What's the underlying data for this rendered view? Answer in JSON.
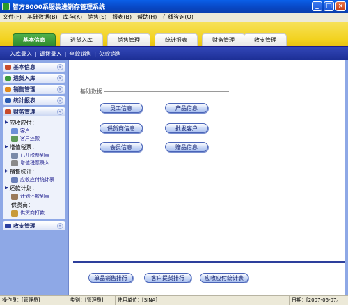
{
  "window": {
    "title": "智方8000系服装进销存管理系统",
    "buttons": {
      "minimize": "_",
      "maximize": "□",
      "close": "×"
    }
  },
  "menu": [
    "文件(F)",
    "基础数据(B)",
    "库存(K)",
    "销售(S)",
    "报表(B)",
    "帮助(H)",
    "在线咨询(O)"
  ],
  "tabs": [
    "基本信息",
    "进货入库",
    "销售管理",
    "统计报表",
    "财务管理",
    "收支管理"
  ],
  "subnav": [
    "入库录入",
    "调拨录入",
    "全款销售",
    "欠款销售"
  ],
  "sidebar": {
    "sections": [
      {
        "label": "基本信息",
        "color": "#c84a2a"
      },
      {
        "label": "进货入库",
        "color": "#3a9a3a"
      },
      {
        "label": "销售管理",
        "color": "#e08a1a"
      },
      {
        "label": "统计报表",
        "color": "#2a5ab0"
      },
      {
        "label": "财务管理",
        "color": "#c84a2a"
      },
      {
        "label": "收支管理",
        "color": "#2a3fa0"
      }
    ],
    "toggle_down": "»",
    "toggle_up": "«",
    "finance": {
      "groups": [
        {
          "label": "应收应付：",
          "items": [
            "客户",
            "客户还款"
          ]
        },
        {
          "label": "增值税票：",
          "items": [
            "已开税票列表",
            "增值税票录入"
          ]
        },
        {
          "label": "销售统计：",
          "items": [
            "应收应付统计表"
          ]
        },
        {
          "label": "还款计划：",
          "items": [
            "计划还款列表"
          ]
        }
      ],
      "supplier_label": "供货商：",
      "supplier_item": "供货商打款"
    }
  },
  "main": {
    "section_title": "基础数据",
    "buttons": [
      "员工信息",
      "产品信息",
      "供货商信息",
      "批发客户",
      "会员信息",
      "赠品信息"
    ],
    "bottom_buttons": [
      "单品销售排行",
      "客户提货排行",
      "应收应付统计表"
    ]
  },
  "status": {
    "operator": "操作员：[管理员]",
    "category": "类别：[管理员]",
    "unit": "使用单位：[SINA]",
    "date": "日期：[2007-06-07。"
  }
}
